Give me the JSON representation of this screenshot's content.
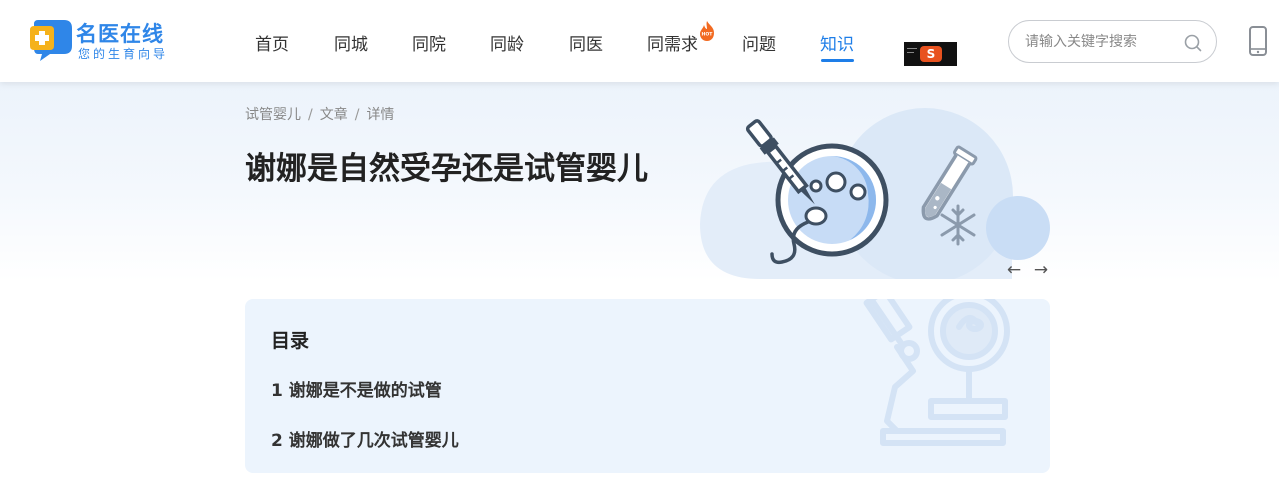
{
  "header": {
    "logo": {
      "name": "名医在线",
      "slogan": "您的生育向导"
    },
    "nav": [
      {
        "label": "首页"
      },
      {
        "label": "同城"
      },
      {
        "label": "同院"
      },
      {
        "label": "同龄"
      },
      {
        "label": "同医"
      },
      {
        "label": "同需求",
        "badge": "HOT"
      },
      {
        "label": "问题"
      },
      {
        "label": "知识",
        "active": true
      }
    ],
    "search": {
      "placeholder": "请输入关键字搜索"
    }
  },
  "breadcrumb": [
    "试管婴儿",
    "文章",
    "详情"
  ],
  "breadcrumb_separator": "/",
  "article": {
    "title": "谢娜是自然受孕还是试管婴儿"
  },
  "carousel": {
    "prev": "←",
    "next": "→"
  },
  "toc": {
    "title": "目录",
    "items": [
      {
        "label": "1 谢娜是不是做的试管"
      },
      {
        "label": "2 谢娜做了几次试管婴儿"
      }
    ]
  },
  "colors": {
    "brand": "#2f86e8",
    "active_nav": "#1e7ee8",
    "toc_bg": "#ecf4fd",
    "hot_badge": "#f26a21"
  },
  "icons": [
    "logo-mark-icon",
    "hot-flame-icon",
    "search-icon",
    "phone-icon",
    "petri-dish-illustration",
    "test-tube-icon",
    "snowflake-icon",
    "microscope-illustration"
  ]
}
